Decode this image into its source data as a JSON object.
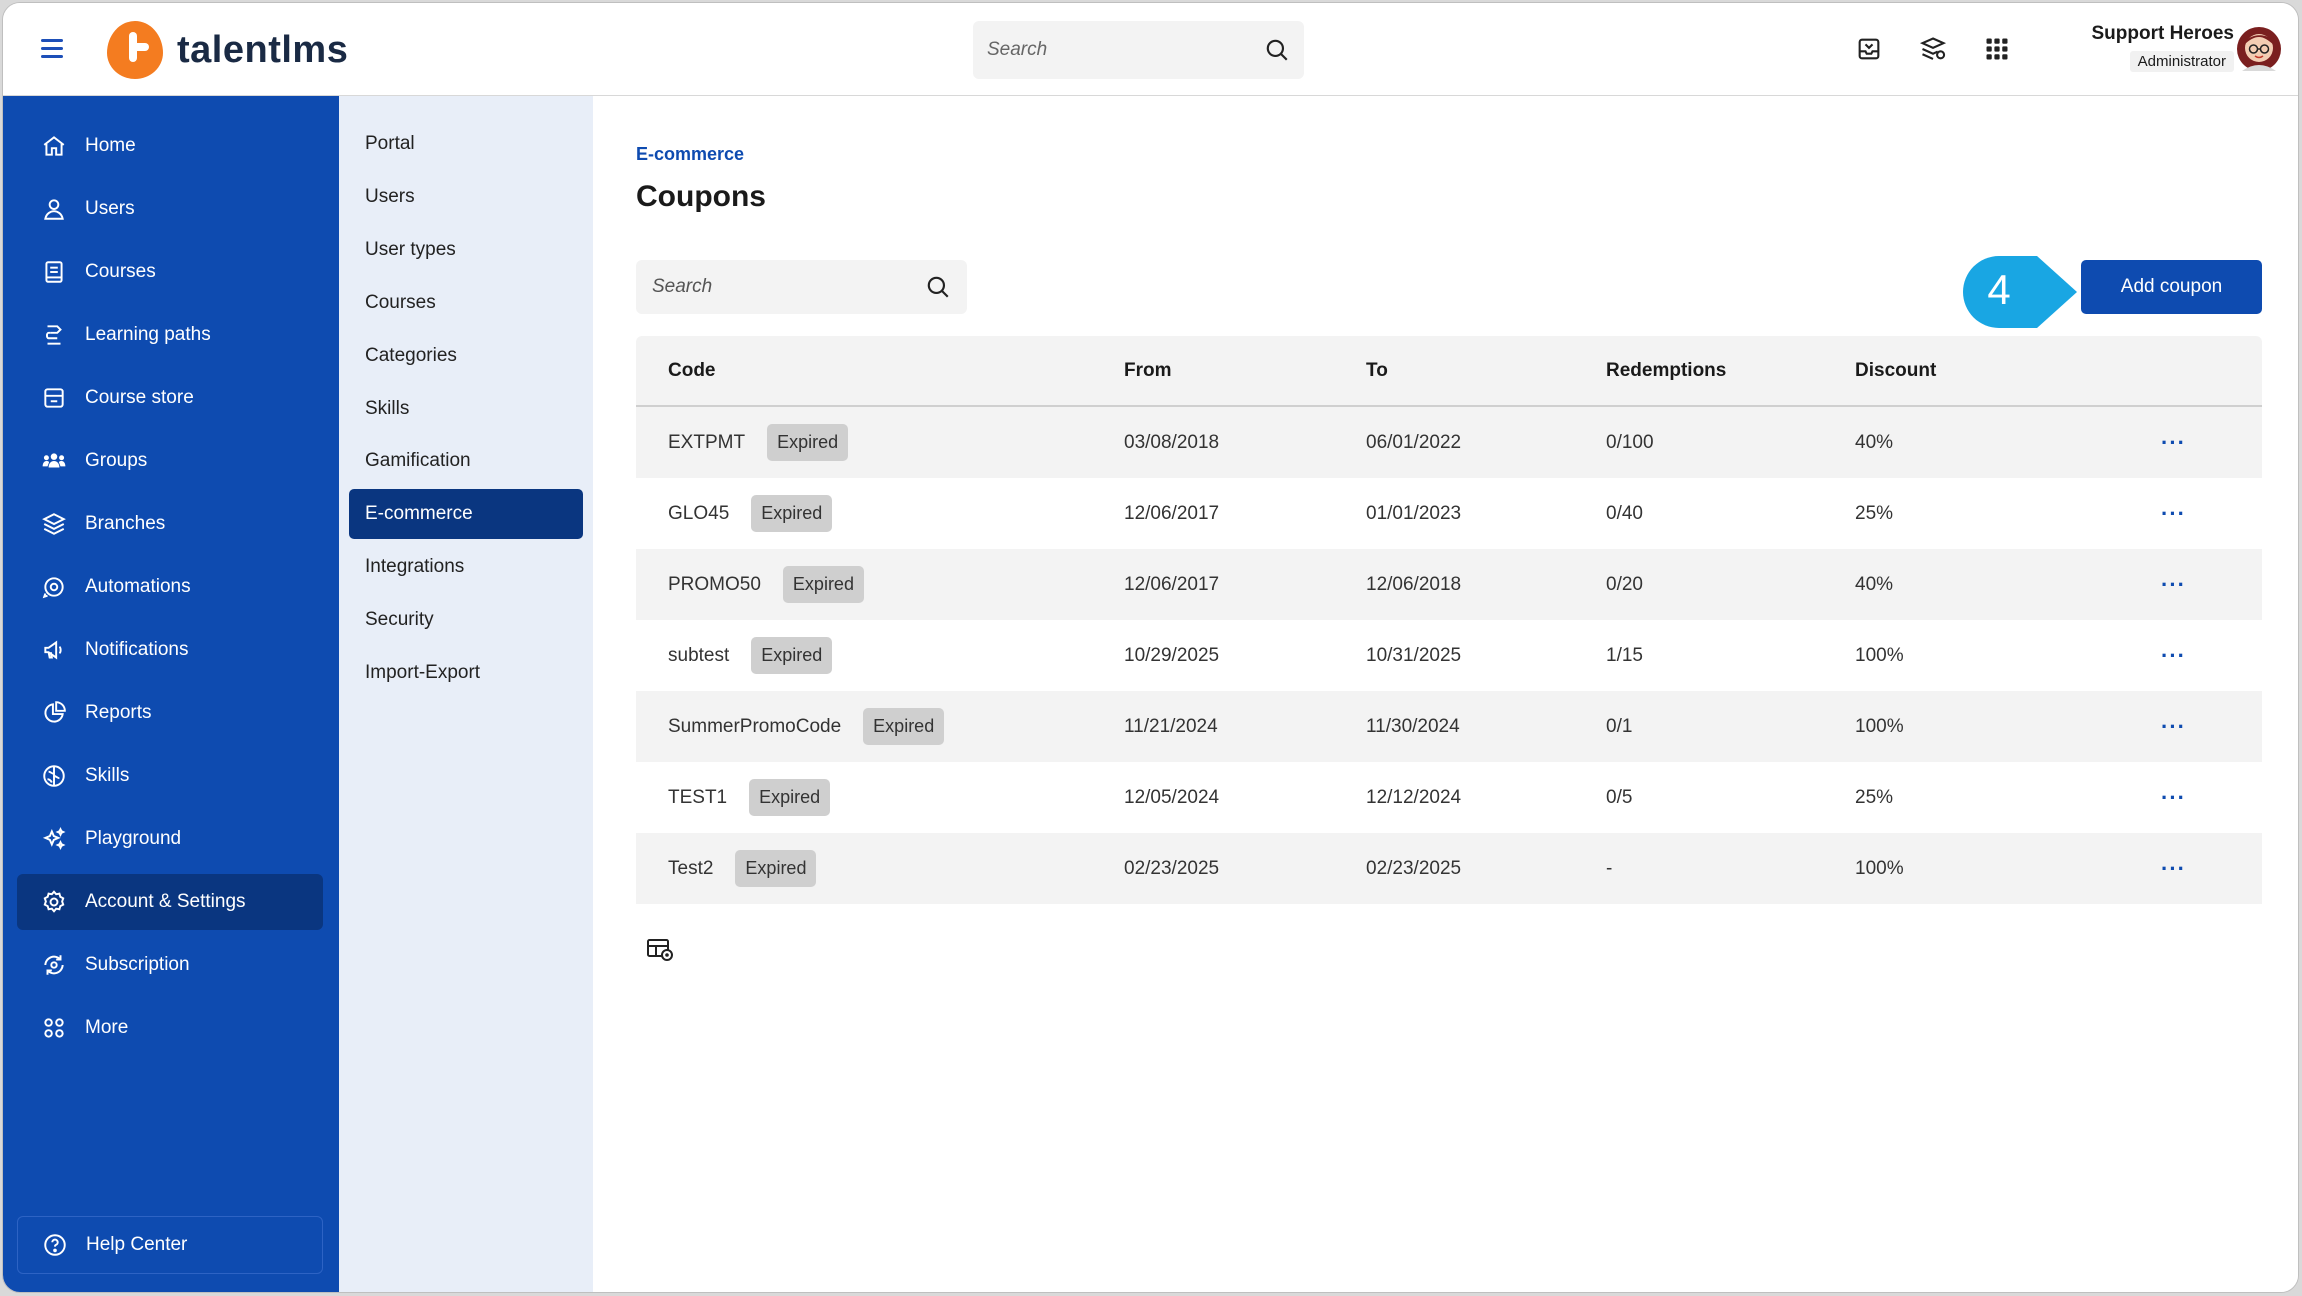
{
  "header": {
    "logo_text": "talentlms",
    "search_placeholder": "Search",
    "user_name": "Support Heroes",
    "user_role": "Administrator"
  },
  "sidebar": {
    "items": [
      {
        "label": "Home",
        "icon": "home-icon"
      },
      {
        "label": "Users",
        "icon": "user-icon"
      },
      {
        "label": "Courses",
        "icon": "book-icon"
      },
      {
        "label": "Learning paths",
        "icon": "path-icon"
      },
      {
        "label": "Course store",
        "icon": "store-icon"
      },
      {
        "label": "Groups",
        "icon": "groups-icon"
      },
      {
        "label": "Branches",
        "icon": "layers-icon"
      },
      {
        "label": "Automations",
        "icon": "automation-icon"
      },
      {
        "label": "Notifications",
        "icon": "megaphone-icon"
      },
      {
        "label": "Reports",
        "icon": "pie-chart-icon"
      },
      {
        "label": "Skills",
        "icon": "brain-icon"
      },
      {
        "label": "Playground",
        "icon": "sparkles-icon"
      },
      {
        "label": "Account & Settings",
        "icon": "gear-icon",
        "active": true
      },
      {
        "label": "Subscription",
        "icon": "subscription-icon"
      },
      {
        "label": "More",
        "icon": "grid-icon"
      }
    ],
    "help_label": "Help Center"
  },
  "subnav": {
    "items": [
      "Portal",
      "Users",
      "User types",
      "Courses",
      "Categories",
      "Skills",
      "Gamification",
      "E-commerce",
      "Integrations",
      "Security",
      "Import-Export"
    ],
    "active": "E-commerce"
  },
  "main": {
    "breadcrumb": "E-commerce",
    "title": "Coupons",
    "search_placeholder": "Search",
    "step_number": "4",
    "add_button": "Add coupon",
    "columns": {
      "code": "Code",
      "from": "From",
      "to": "To",
      "redemptions": "Redemptions",
      "discount": "Discount"
    },
    "rows": [
      {
        "code": "EXTPMT",
        "status": "Expired",
        "from": "03/08/2018",
        "to": "06/01/2022",
        "redemptions": "0/100",
        "discount": "40%"
      },
      {
        "code": "GLO45",
        "status": "Expired",
        "from": "12/06/2017",
        "to": "01/01/2023",
        "redemptions": "0/40",
        "discount": "25%"
      },
      {
        "code": "PROMO50",
        "status": "Expired",
        "from": "12/06/2017",
        "to": "12/06/2018",
        "redemptions": "0/20",
        "discount": "40%"
      },
      {
        "code": "subtest",
        "status": "Expired",
        "from": "10/29/2025",
        "to": "10/31/2025",
        "redemptions": "1/15",
        "discount": "100%"
      },
      {
        "code": "SummerPromoCode",
        "status": "Expired",
        "from": "11/21/2024",
        "to": "11/30/2024",
        "redemptions": "0/1",
        "discount": "100%"
      },
      {
        "code": "TEST1",
        "status": "Expired",
        "from": "12/05/2024",
        "to": "12/12/2024",
        "redemptions": "0/5",
        "discount": "25%"
      },
      {
        "code": "Test2",
        "status": "Expired",
        "from": "02/23/2025",
        "to": "02/23/2025",
        "redemptions": "-",
        "discount": "100%"
      }
    ],
    "row_actions": "···"
  },
  "colors": {
    "primary": "#0e4bb0",
    "active_nav": "#0a3680",
    "logo_orange": "#f47c20",
    "step_badge": "#19a6e3"
  }
}
